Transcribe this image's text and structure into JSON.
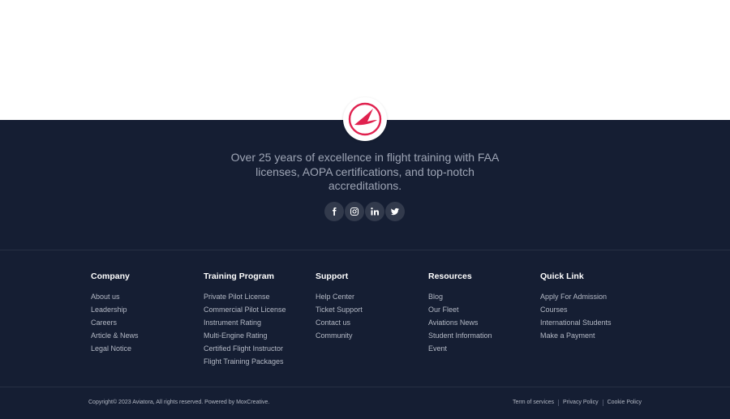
{
  "footer": {
    "tagline": "Over 25 years of excellence in flight training with FAA licenses, AOPA certifications, and top-notch accreditations.",
    "brand_color": "#e0224f",
    "socials": [
      {
        "icon": "facebook-icon"
      },
      {
        "icon": "instagram-icon"
      },
      {
        "icon": "linkedin-icon"
      },
      {
        "icon": "twitter-icon"
      }
    ],
    "columns": [
      {
        "title": "Company",
        "links": [
          "About us",
          "Leadership",
          "Careers",
          "Article & News",
          "Legal Notice"
        ]
      },
      {
        "title": "Training Program",
        "links": [
          "Private Pilot License",
          "Commercial Pilot License",
          "Instrument Rating",
          "Multi-Engine Rating",
          "Certified Flight Instructor",
          "Flight Training Packages"
        ]
      },
      {
        "title": "Support",
        "links": [
          "Help Center",
          "Ticket Support",
          "Contact us",
          "Community"
        ]
      },
      {
        "title": "Resources",
        "links": [
          "Blog",
          "Our Fleet",
          "Aviations News",
          "Student Information",
          "Event"
        ]
      },
      {
        "title": "Quick Link",
        "links": [
          "Apply For Admission",
          "Courses",
          "International Students",
          "Make a Payment"
        ]
      }
    ],
    "copyright": "Copyright© 2023 Aviatora, All rights reserved. Powered by MoxCreative.",
    "legal_links": [
      "Term of services",
      "Privacy Policy",
      "Cookie Policy"
    ]
  }
}
